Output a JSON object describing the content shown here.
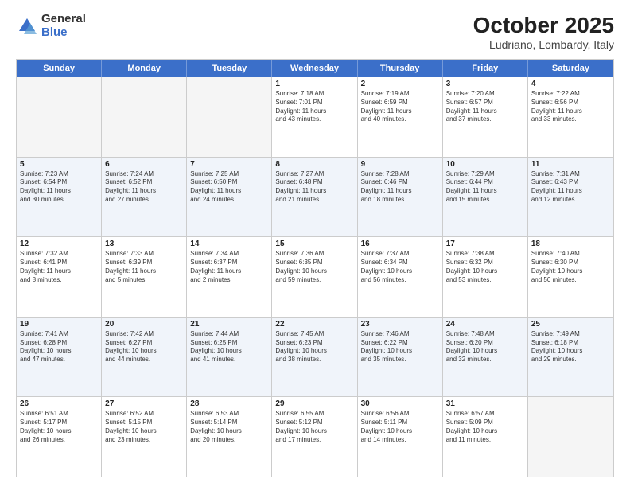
{
  "header": {
    "logo": {
      "general": "General",
      "blue": "Blue"
    },
    "title": "October 2025",
    "location": "Ludriano, Lombardy, Italy"
  },
  "weekdays": [
    "Sunday",
    "Monday",
    "Tuesday",
    "Wednesday",
    "Thursday",
    "Friday",
    "Saturday"
  ],
  "rows": [
    {
      "alt": false,
      "cells": [
        {
          "day": "",
          "info": ""
        },
        {
          "day": "",
          "info": ""
        },
        {
          "day": "",
          "info": ""
        },
        {
          "day": "1",
          "info": "Sunrise: 7:18 AM\nSunset: 7:01 PM\nDaylight: 11 hours\nand 43 minutes."
        },
        {
          "day": "2",
          "info": "Sunrise: 7:19 AM\nSunset: 6:59 PM\nDaylight: 11 hours\nand 40 minutes."
        },
        {
          "day": "3",
          "info": "Sunrise: 7:20 AM\nSunset: 6:57 PM\nDaylight: 11 hours\nand 37 minutes."
        },
        {
          "day": "4",
          "info": "Sunrise: 7:22 AM\nSunset: 6:56 PM\nDaylight: 11 hours\nand 33 minutes."
        }
      ]
    },
    {
      "alt": true,
      "cells": [
        {
          "day": "5",
          "info": "Sunrise: 7:23 AM\nSunset: 6:54 PM\nDaylight: 11 hours\nand 30 minutes."
        },
        {
          "day": "6",
          "info": "Sunrise: 7:24 AM\nSunset: 6:52 PM\nDaylight: 11 hours\nand 27 minutes."
        },
        {
          "day": "7",
          "info": "Sunrise: 7:25 AM\nSunset: 6:50 PM\nDaylight: 11 hours\nand 24 minutes."
        },
        {
          "day": "8",
          "info": "Sunrise: 7:27 AM\nSunset: 6:48 PM\nDaylight: 11 hours\nand 21 minutes."
        },
        {
          "day": "9",
          "info": "Sunrise: 7:28 AM\nSunset: 6:46 PM\nDaylight: 11 hours\nand 18 minutes."
        },
        {
          "day": "10",
          "info": "Sunrise: 7:29 AM\nSunset: 6:44 PM\nDaylight: 11 hours\nand 15 minutes."
        },
        {
          "day": "11",
          "info": "Sunrise: 7:31 AM\nSunset: 6:43 PM\nDaylight: 11 hours\nand 12 minutes."
        }
      ]
    },
    {
      "alt": false,
      "cells": [
        {
          "day": "12",
          "info": "Sunrise: 7:32 AM\nSunset: 6:41 PM\nDaylight: 11 hours\nand 8 minutes."
        },
        {
          "day": "13",
          "info": "Sunrise: 7:33 AM\nSunset: 6:39 PM\nDaylight: 11 hours\nand 5 minutes."
        },
        {
          "day": "14",
          "info": "Sunrise: 7:34 AM\nSunset: 6:37 PM\nDaylight: 11 hours\nand 2 minutes."
        },
        {
          "day": "15",
          "info": "Sunrise: 7:36 AM\nSunset: 6:35 PM\nDaylight: 10 hours\nand 59 minutes."
        },
        {
          "day": "16",
          "info": "Sunrise: 7:37 AM\nSunset: 6:34 PM\nDaylight: 10 hours\nand 56 minutes."
        },
        {
          "day": "17",
          "info": "Sunrise: 7:38 AM\nSunset: 6:32 PM\nDaylight: 10 hours\nand 53 minutes."
        },
        {
          "day": "18",
          "info": "Sunrise: 7:40 AM\nSunset: 6:30 PM\nDaylight: 10 hours\nand 50 minutes."
        }
      ]
    },
    {
      "alt": true,
      "cells": [
        {
          "day": "19",
          "info": "Sunrise: 7:41 AM\nSunset: 6:28 PM\nDaylight: 10 hours\nand 47 minutes."
        },
        {
          "day": "20",
          "info": "Sunrise: 7:42 AM\nSunset: 6:27 PM\nDaylight: 10 hours\nand 44 minutes."
        },
        {
          "day": "21",
          "info": "Sunrise: 7:44 AM\nSunset: 6:25 PM\nDaylight: 10 hours\nand 41 minutes."
        },
        {
          "day": "22",
          "info": "Sunrise: 7:45 AM\nSunset: 6:23 PM\nDaylight: 10 hours\nand 38 minutes."
        },
        {
          "day": "23",
          "info": "Sunrise: 7:46 AM\nSunset: 6:22 PM\nDaylight: 10 hours\nand 35 minutes."
        },
        {
          "day": "24",
          "info": "Sunrise: 7:48 AM\nSunset: 6:20 PM\nDaylight: 10 hours\nand 32 minutes."
        },
        {
          "day": "25",
          "info": "Sunrise: 7:49 AM\nSunset: 6:18 PM\nDaylight: 10 hours\nand 29 minutes."
        }
      ]
    },
    {
      "alt": false,
      "cells": [
        {
          "day": "26",
          "info": "Sunrise: 6:51 AM\nSunset: 5:17 PM\nDaylight: 10 hours\nand 26 minutes."
        },
        {
          "day": "27",
          "info": "Sunrise: 6:52 AM\nSunset: 5:15 PM\nDaylight: 10 hours\nand 23 minutes."
        },
        {
          "day": "28",
          "info": "Sunrise: 6:53 AM\nSunset: 5:14 PM\nDaylight: 10 hours\nand 20 minutes."
        },
        {
          "day": "29",
          "info": "Sunrise: 6:55 AM\nSunset: 5:12 PM\nDaylight: 10 hours\nand 17 minutes."
        },
        {
          "day": "30",
          "info": "Sunrise: 6:56 AM\nSunset: 5:11 PM\nDaylight: 10 hours\nand 14 minutes."
        },
        {
          "day": "31",
          "info": "Sunrise: 6:57 AM\nSunset: 5:09 PM\nDaylight: 10 hours\nand 11 minutes."
        },
        {
          "day": "",
          "info": ""
        }
      ]
    }
  ]
}
